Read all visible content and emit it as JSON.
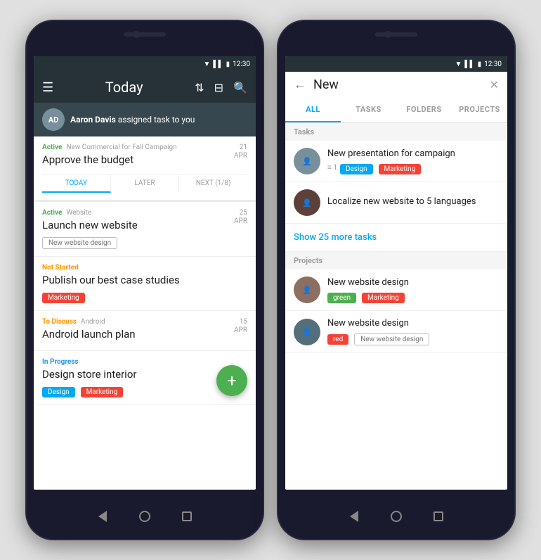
{
  "left_phone": {
    "status_bar": {
      "time": "12:30"
    },
    "header": {
      "menu_icon": "☰",
      "title": "Today",
      "sort_icon": "⇅",
      "filter_icon": "⊟",
      "search_icon": "🔍"
    },
    "notification": {
      "user_name": "Aaron Davis",
      "message": " assigned task to you"
    },
    "task1": {
      "status": "Active",
      "context": "New Commercial for Fall Campaign",
      "title": "Approve the budget",
      "date_day": "21",
      "date_month": "APR",
      "tab1": "TODAY",
      "tab2": "LATER",
      "tab3": "NEXT (1/8)"
    },
    "task2": {
      "status": "Active",
      "context": "Website",
      "title": "Launch new website",
      "date_day": "25",
      "date_month": "APR",
      "tag": "New website design"
    },
    "task3": {
      "status": "Not Started",
      "title": "Publish our best case studies",
      "tag": "Marketing"
    },
    "task4": {
      "status": "To Discuss",
      "context": "Android",
      "title": "Android launch plan",
      "date_day": "15",
      "date_month": "APR"
    },
    "task5": {
      "status": "In Progress",
      "title": "Design store interior",
      "tag1": "Design",
      "tag2": "Marketing"
    },
    "fab_label": "+"
  },
  "right_phone": {
    "status_bar": {
      "time": "12:30"
    },
    "search": {
      "back_icon": "←",
      "query": "New",
      "clear_icon": "✕"
    },
    "tabs": [
      {
        "label": "ALL",
        "active": true
      },
      {
        "label": "TASKS",
        "active": false
      },
      {
        "label": "FOLDERS",
        "active": false
      },
      {
        "label": "PROJECTS",
        "active": false
      }
    ],
    "tasks_section_label": "Tasks",
    "task_results": [
      {
        "title": "New presentation for campaign",
        "count": "1",
        "tag1": "Design",
        "tag2": "Marketing",
        "avatar_bg": "#78909c"
      },
      {
        "title": "Localize new website to 5 languages",
        "avatar_bg": "#5d4037"
      }
    ],
    "show_more": "Show 25 more tasks",
    "projects_section_label": "Projects",
    "project_results": [
      {
        "title": "New website design",
        "tag_color": "green",
        "tag_label": "green",
        "tag2": "Marketing",
        "avatar_bg": "#8d6e63"
      },
      {
        "title": "New website design",
        "tag_color": "red",
        "tag_label": "red",
        "tag2_label": "New website design",
        "avatar_bg": "#546e7a"
      }
    ]
  }
}
